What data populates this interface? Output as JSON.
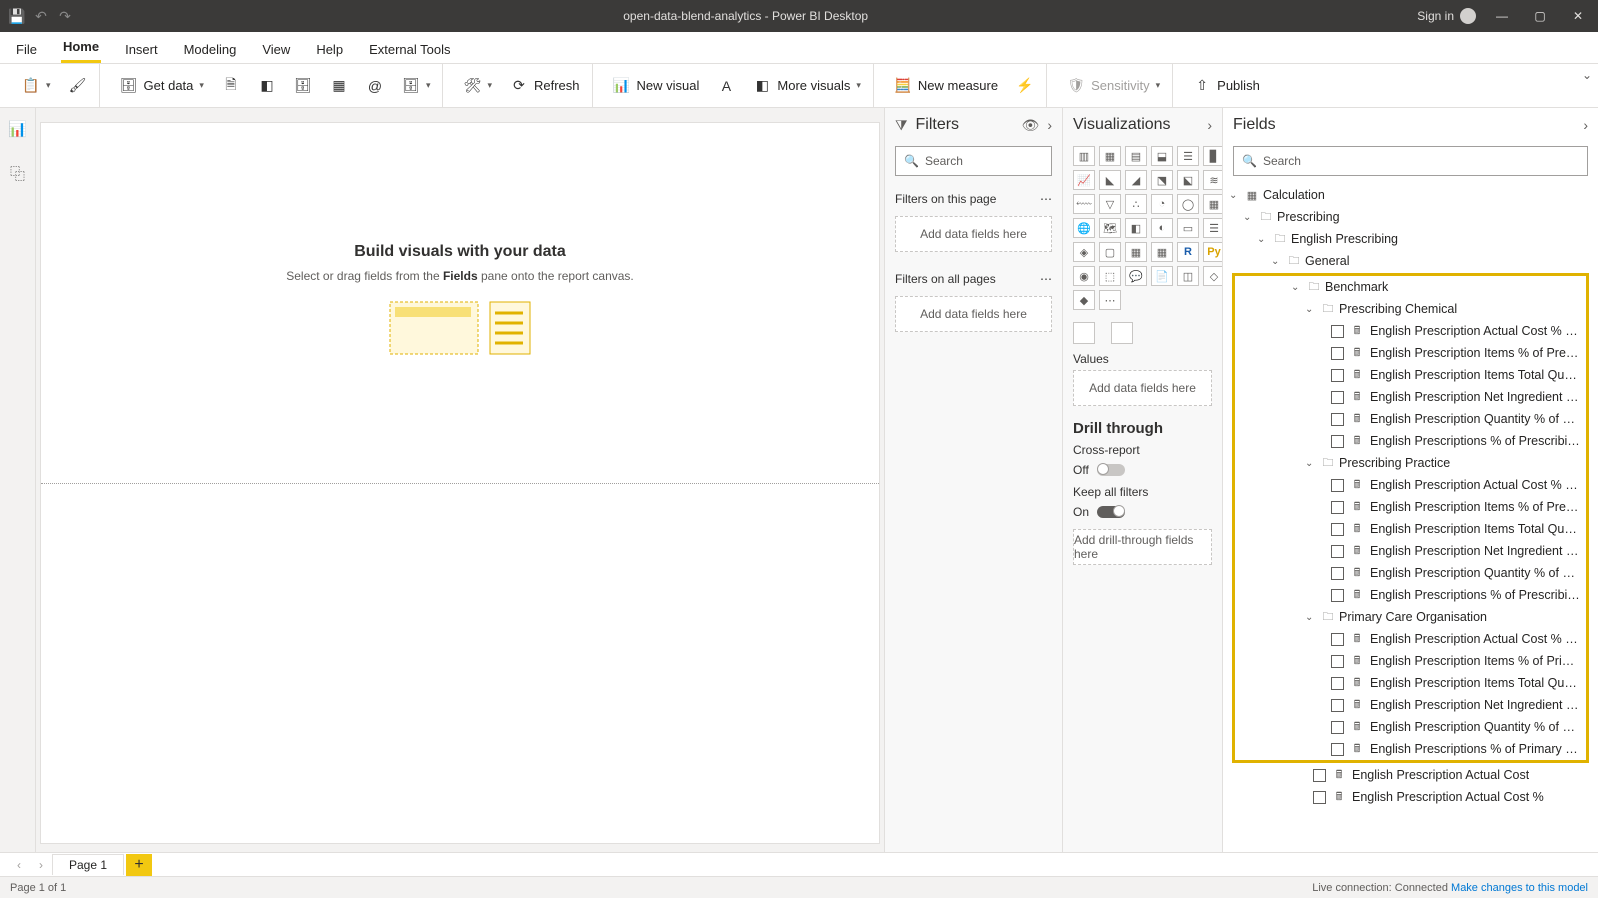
{
  "titlebar": {
    "title": "open-data-blend-analytics - Power BI Desktop",
    "signin": "Sign in"
  },
  "menu": {
    "file": "File",
    "home": "Home",
    "insert": "Insert",
    "modeling": "Modeling",
    "view": "View",
    "help": "Help",
    "external": "External Tools"
  },
  "ribbon": {
    "get_data": "Get data",
    "refresh": "Refresh",
    "new_visual": "New visual",
    "more_visuals": "More visuals",
    "new_measure": "New measure",
    "sensitivity": "Sensitivity",
    "publish": "Publish"
  },
  "canvas": {
    "title": "Build visuals with your data",
    "subtitle_a": "Select or drag fields from the ",
    "subtitle_b": "Fields",
    "subtitle_c": " pane onto the report canvas."
  },
  "filters": {
    "title": "Filters",
    "search_ph": "Search",
    "on_page": "Filters on this page",
    "on_all": "Filters on all pages",
    "add_here": "Add data fields here"
  },
  "viz": {
    "title": "Visualizations",
    "values": "Values",
    "add_here": "Add data fields here",
    "drill": "Drill through",
    "cross": "Cross-report",
    "off": "Off",
    "keep": "Keep all filters",
    "on": "On",
    "add_drill": "Add drill-through fields here"
  },
  "fields": {
    "title": "Fields",
    "search_ph": "Search",
    "tree": {
      "calculation": "Calculation",
      "prescribing": "Prescribing",
      "english_prescribing": "English Prescribing",
      "general": "General",
      "benchmark": "Benchmark",
      "prescribing_chemical": "Prescribing Chemical",
      "chem": [
        "English Prescription Actual Cost % of Prescribi...",
        "English Prescription Items % of Prescribing Ch...",
        "English Prescription Items Total Quantity % of ...",
        "English Prescription Net Ingredient Cost % of ...",
        "English Prescription Quantity % of Prescribing ...",
        "English Prescriptions % of Prescribing Chemicals"
      ],
      "prescribing_practice": "Prescribing Practice",
      "prac": [
        "English Prescription Actual Cost % of Prescribi...",
        "English Prescription Items % of Prescribing Pra...",
        "English Prescription Items Total Quantity % of ...",
        "English Prescription Net Ingredient Cost % of ...",
        "English Prescription Quantity % of Prescribing ...",
        "English Prescriptions % of Prescribing Practices"
      ],
      "primary_care": "Primary Care Organisation",
      "pco": [
        "English Prescription Actual Cost % of Primary ...",
        "English Prescription Items % of Primary Care O...",
        "English Prescription Items Total Quantity % of ...",
        "English Prescription Net Ingredient Cost % of ...",
        "English Prescription Quantity % of Primary Car...",
        "English Prescriptions % of Primary Care Organi..."
      ],
      "extra1": "English Prescription Actual Cost",
      "extra2": "English Prescription Actual Cost %"
    }
  },
  "page_tabs": {
    "page1": "Page 1"
  },
  "status": {
    "left": "Page 1 of 1",
    "conn": "Live connection: Connected",
    "link": "Make changes to this model"
  }
}
